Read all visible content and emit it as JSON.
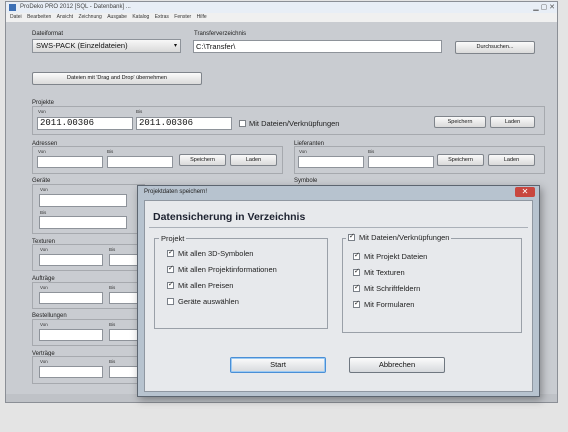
{
  "window": {
    "title": "ProDeko PRO 2012 [SQL - Datenbank] ..."
  },
  "menu": [
    "Datei",
    "Bearbeiten",
    "Ansicht",
    "Zeichnung",
    "Ausgabe",
    "Katalog",
    "Extras",
    "Fenster",
    "Hilfe"
  ],
  "main": {
    "dateiformat_label": "Dateiformat",
    "dateiformat_value": "SWS-PACK (Einzeldateien)",
    "transfer_label": "Transferverzeichnis",
    "transfer_value": "C:\\Transfer\\",
    "browse_button": "Durchsuchen...",
    "dragdrop_button": "Dateien mit 'Drag and Drop' übernehmen",
    "projekte_label": "Projekte",
    "von_label": "Von",
    "bis_label": "Bis",
    "projekte_von": "2011.00306",
    "projekte_bis": "2011.00306",
    "mit_dateien_label": "Mit Dateien/Verknüpfungen",
    "save_button": "Speichern",
    "load_button": "Laden",
    "adressen_label": "Adressen",
    "lieferanten_label": "Lieferanten",
    "geraete_label": "Geräte",
    "symbole_label": "Symbole",
    "texturen_label": "Texturen",
    "auftraege_label": "Aufträge",
    "bestellungen_label": "Bestellungen",
    "vorlagen_label": "Verträge"
  },
  "dialog": {
    "title": "Projektdaten speichern!",
    "heading": "Datensicherung in Verzeichnis",
    "left_group_label": "Projekt",
    "left_options": [
      {
        "label": "Mit allen 3D-Symbolen",
        "checked": true
      },
      {
        "label": "Mit allen Projektinformationen",
        "checked": true
      },
      {
        "label": "Mit allen Preisen",
        "checked": true
      },
      {
        "label": "Geräte auswählen",
        "checked": false
      }
    ],
    "right_group_label": "Mit Dateien/Verknüpfungen",
    "right_group_checked": true,
    "right_options": [
      {
        "label": "Mit Projekt Dateien",
        "checked": true
      },
      {
        "label": "Mit Texturen",
        "checked": true
      },
      {
        "label": "Mit Schriftfeldern",
        "checked": true
      },
      {
        "label": "Mit Formularen",
        "checked": true
      }
    ],
    "start_button": "Start",
    "cancel_button": "Abbrechen",
    "close_glyph": "✕"
  }
}
